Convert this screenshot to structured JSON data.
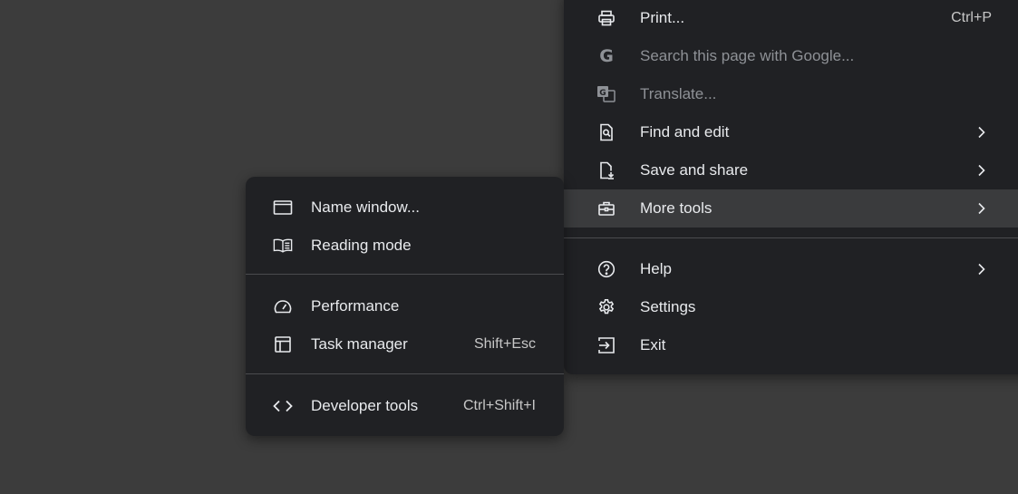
{
  "main_menu": {
    "items": [
      {
        "label": "Print...",
        "shortcut": "Ctrl+P",
        "icon": "printer-icon"
      },
      {
        "label": "Search this page with Google...",
        "icon": "google-icon",
        "disabled": true
      },
      {
        "label": "Translate...",
        "icon": "translate-icon",
        "disabled": true
      },
      {
        "label": "Find and edit",
        "icon": "find-page-icon",
        "submenu": true
      },
      {
        "label": "Save and share",
        "icon": "save-share-icon",
        "submenu": true
      },
      {
        "label": "More tools",
        "icon": "toolbox-icon",
        "submenu": true,
        "highlighted": true
      },
      {
        "label": "Help",
        "icon": "help-icon",
        "submenu": true
      },
      {
        "label": "Settings",
        "icon": "gear-icon"
      },
      {
        "label": "Exit",
        "icon": "exit-icon"
      }
    ]
  },
  "more_tools_menu": {
    "items": [
      {
        "label": "Name window...",
        "icon": "window-icon"
      },
      {
        "label": "Reading mode",
        "icon": "book-icon"
      },
      {
        "label": "Performance",
        "icon": "speedometer-icon"
      },
      {
        "label": "Task manager",
        "shortcut": "Shift+Esc",
        "icon": "task-manager-icon"
      },
      {
        "label": "Developer tools",
        "shortcut": "Ctrl+Shift+I",
        "icon": "code-icon"
      }
    ]
  },
  "colors": {
    "background": "#3c3c3c",
    "menu_bg": "#202124",
    "highlight": "#3a3b3d",
    "text": "#e8eaed",
    "disabled_text": "#8e9196"
  }
}
